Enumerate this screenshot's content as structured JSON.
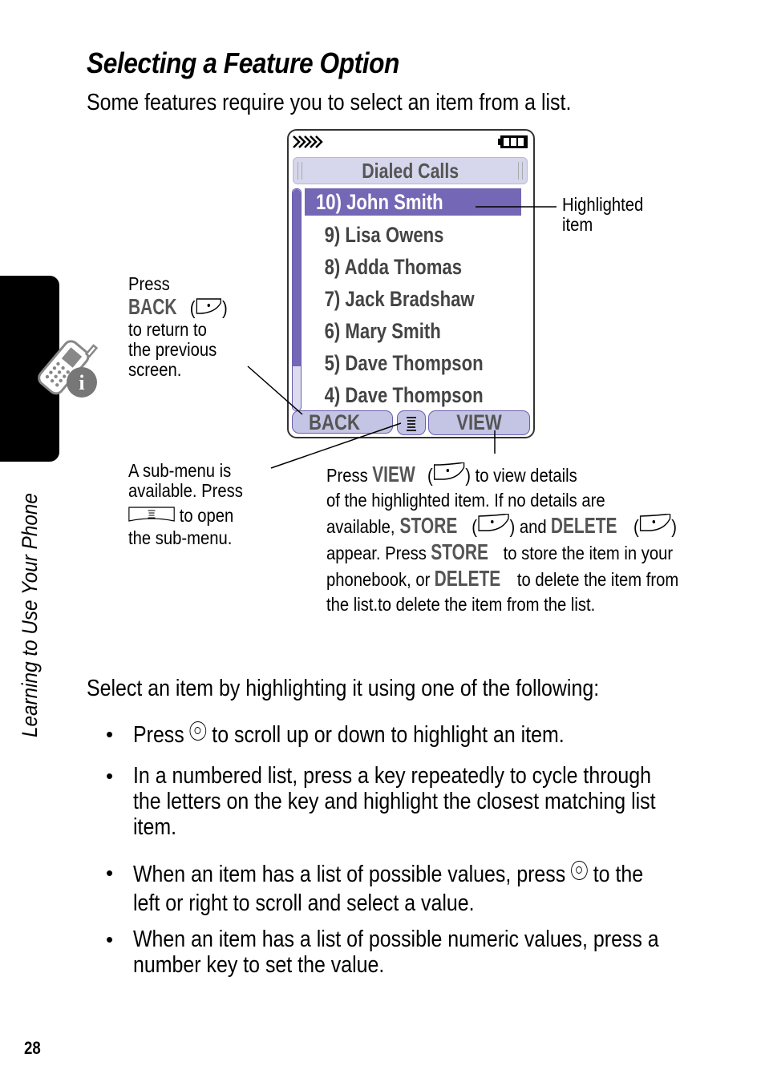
{
  "page": {
    "title": "Selecting a Feature Option",
    "intro": "Some features require you to select an item from a list.",
    "side_tab_label": "Learning to Use Your Phone",
    "page_number": "28"
  },
  "phone_screen": {
    "header": "Dialed Calls",
    "highlighted_index": 0,
    "items": [
      "10) John Smith",
      "9) Lisa Owens",
      "8) Adda Thomas",
      "7) Jack Bradshaw",
      "6) Mary Smith",
      "5) Dave Thompson",
      "4) Dave Thompson"
    ],
    "softkeys": {
      "left": "BACK",
      "right": "VIEW",
      "center_icon": "menu-icon"
    },
    "scroll_position_fraction": 0.8,
    "highlight_color": "#7467b5"
  },
  "callouts": {
    "highlighted_item": {
      "line1": "Highlighted",
      "line2": "item"
    },
    "back": {
      "line1": "Press",
      "key": "BACK",
      "line3": "to return to",
      "line4": "the previous",
      "line5": "screen."
    },
    "submenu": {
      "line1": "A sub-menu is",
      "line2": "available. Press",
      "line3": "to open",
      "line4": "the sub-menu."
    },
    "view": {
      "press": "Press",
      "view_key": "VIEW",
      "after_view": "to view details",
      "line2": "of the highlighted item. If no details are",
      "line3_pre": "available,",
      "store_key": "STORE",
      "and": "and",
      "delete_key": "DELETE",
      "line4_pre": "appear. Press",
      "line4_post": "to store the item in your",
      "line5_pre": "phonebook, or",
      "line5_post": "to delete the item from",
      "line6": "the list.to delete the item from the list."
    }
  },
  "body": {
    "lead": "Select an item by highlighting it using one of the following:",
    "bullets": [
      {
        "pre": "Press",
        "post": "to scroll up or down to highlight an item."
      },
      {
        "lines": [
          "In a numbered list, press a key repeatedly to cycle through",
          "the letters on the key and highlight the closest matching list",
          "item."
        ]
      },
      {
        "pre": "When an item has a list of possible values, press",
        "post": "to the",
        "line2": "left or right to scroll and select a value."
      },
      {
        "lines": [
          "When an item has a list of possible numeric values, press a",
          "number key to set the value."
        ]
      }
    ],
    "bullet_char": "•"
  }
}
